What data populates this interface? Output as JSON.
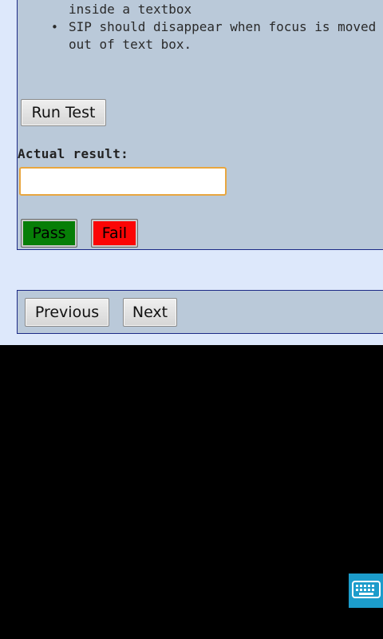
{
  "test": {
    "expected_items": [
      "SIP should appear when focus is put inside a textbox",
      "SIP should disappear when focus is moved out of text box."
    ],
    "run_button": "Run Test",
    "actual_result_label": "Actual result:",
    "actual_result_value": "",
    "pass_button": "Pass",
    "fail_button": "Fail"
  },
  "navigation": {
    "previous_button": "Previous",
    "next_button": "Next"
  },
  "system": {
    "keyboard_toggle_icon": "keyboard-icon"
  },
  "colors": {
    "panel_bg": "#bac9d9",
    "page_bg": "#dde8fb",
    "pass": "#077e07",
    "fail": "#fb0505",
    "input_focus_border": "#e8a640",
    "keyboard_toggle": "#1c9ccb"
  }
}
